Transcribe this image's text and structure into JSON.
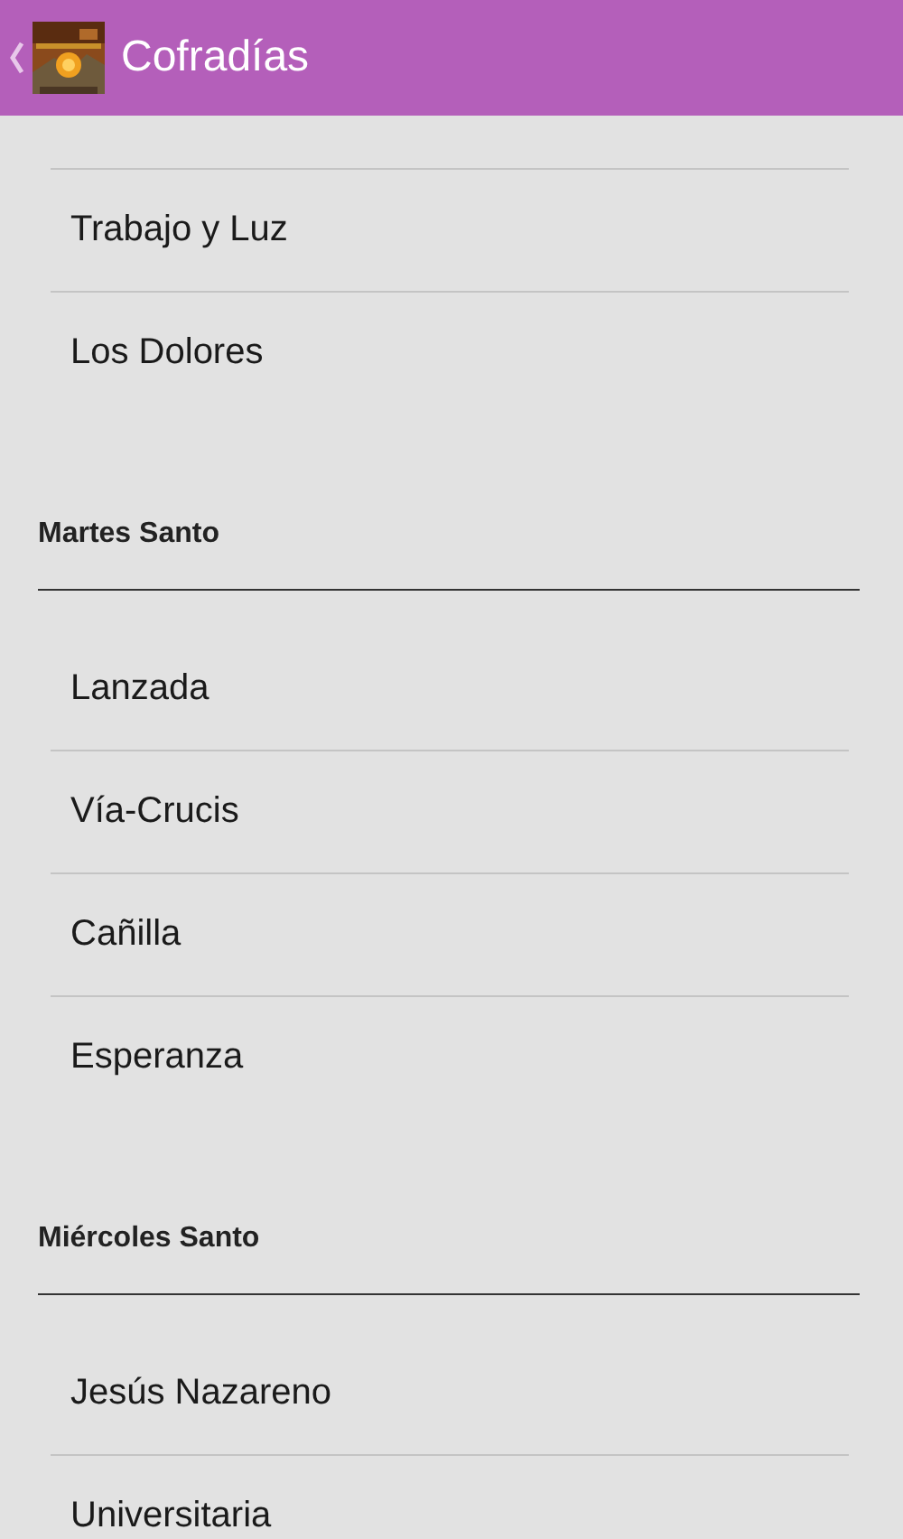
{
  "app_bar": {
    "title": "Cofradías"
  },
  "sections": [
    {
      "items": [
        "Trabajo y Luz",
        "Los Dolores"
      ]
    },
    {
      "title": "Martes Santo",
      "items": [
        "Lanzada",
        "Vía-Crucis",
        "Cañilla",
        "Esperanza"
      ]
    },
    {
      "title": "Miércoles Santo",
      "items": [
        "Jesús Nazareno",
        "Universitaria"
      ]
    }
  ]
}
